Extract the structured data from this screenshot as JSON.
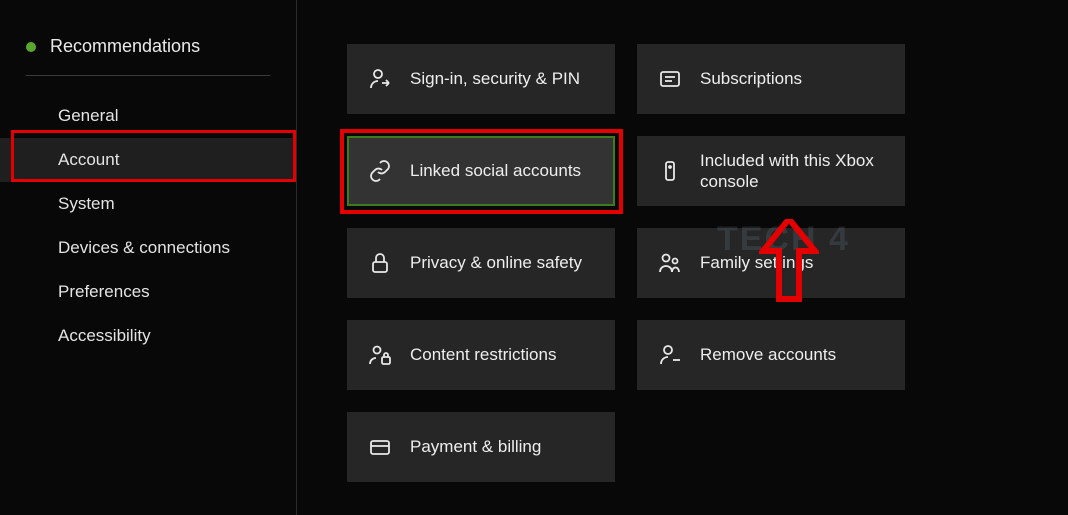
{
  "sidebar": {
    "header": "Recommendations",
    "items": [
      {
        "label": "General"
      },
      {
        "label": "Account"
      },
      {
        "label": "System"
      },
      {
        "label": "Devices & connections"
      },
      {
        "label": "Preferences"
      },
      {
        "label": "Accessibility"
      }
    ],
    "selected_index": 1
  },
  "tiles": {
    "signin": {
      "label": "Sign-in, security & PIN"
    },
    "subscriptions": {
      "label": "Subscriptions"
    },
    "linked": {
      "label": "Linked social accounts"
    },
    "included": {
      "label": "Included with this Xbox console"
    },
    "privacy": {
      "label": "Privacy & online safety"
    },
    "family": {
      "label": "Family settings"
    },
    "content": {
      "label": "Content restrictions"
    },
    "remove": {
      "label": "Remove accounts"
    },
    "payment": {
      "label": "Payment & billing"
    }
  },
  "highlighted_tile": "linked",
  "annotations": {
    "sidebar_highlight": "Account",
    "tile_highlight": "Linked social accounts"
  },
  "watermark": "TECH 4  "
}
